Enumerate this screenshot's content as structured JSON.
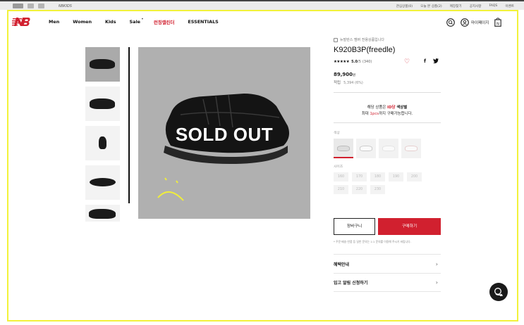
{
  "topbar": {
    "brand_secondary": "NBKIDS",
    "links": [
      "관심상품(0)",
      "오늘 본 상품(2)",
      "매장찾기",
      "공지사항",
      "FAQS",
      "이벤트"
    ]
  },
  "nav": {
    "menu": [
      {
        "label": "Men",
        "highlight": false
      },
      {
        "label": "Women",
        "highlight": false
      },
      {
        "label": "Kids",
        "highlight": false
      },
      {
        "label": "Sale",
        "highlight": false,
        "badge": "*"
      },
      {
        "label": "런칭캘린더",
        "highlight": true
      },
      {
        "label": "ESSENTIALS",
        "highlight": false
      }
    ],
    "mypage_label": "마이페이지"
  },
  "gallery": {
    "thumb_count": 5,
    "overlay_text": "SOLD OUT"
  },
  "product": {
    "member_note": "뉴발란스 멤버 전용상품입니다",
    "name": "K920B3P(freedle)",
    "stars": "★★★★★",
    "rating": "5.0",
    "rating_unit": "/5",
    "review_count": "(340)",
    "price": "89,900",
    "price_unit": "원",
    "points_label": "적립",
    "points_value": "5,394 (6%)"
  },
  "notice": {
    "line1_a": "해당 상품은 ",
    "line1_b": "ID당",
    "line1_c": " 색상별",
    "line2_a": "최대 ",
    "line2_b": "1pcs",
    "line2_c": "까지 구매가능합니다."
  },
  "options": {
    "color_label": "색상",
    "size_label": "사이즈",
    "sizes": [
      "160",
      "170",
      "180",
      "190",
      "200",
      "210",
      "220",
      "230"
    ]
  },
  "actions": {
    "cart": "장바구니",
    "buy": "구매하기",
    "fineprint": "* 주문·배송·반품 등 일반 문의는 1:1 문의를 이용해 주시기 바랍니다."
  },
  "rows": [
    {
      "label": "혜택안내"
    },
    {
      "label": "입고 알림 신청하기"
    }
  ],
  "colors": {
    "accent": "#d1202f",
    "highlight_frame": "#f2f23a",
    "image_bg": "#b0b0b0"
  }
}
